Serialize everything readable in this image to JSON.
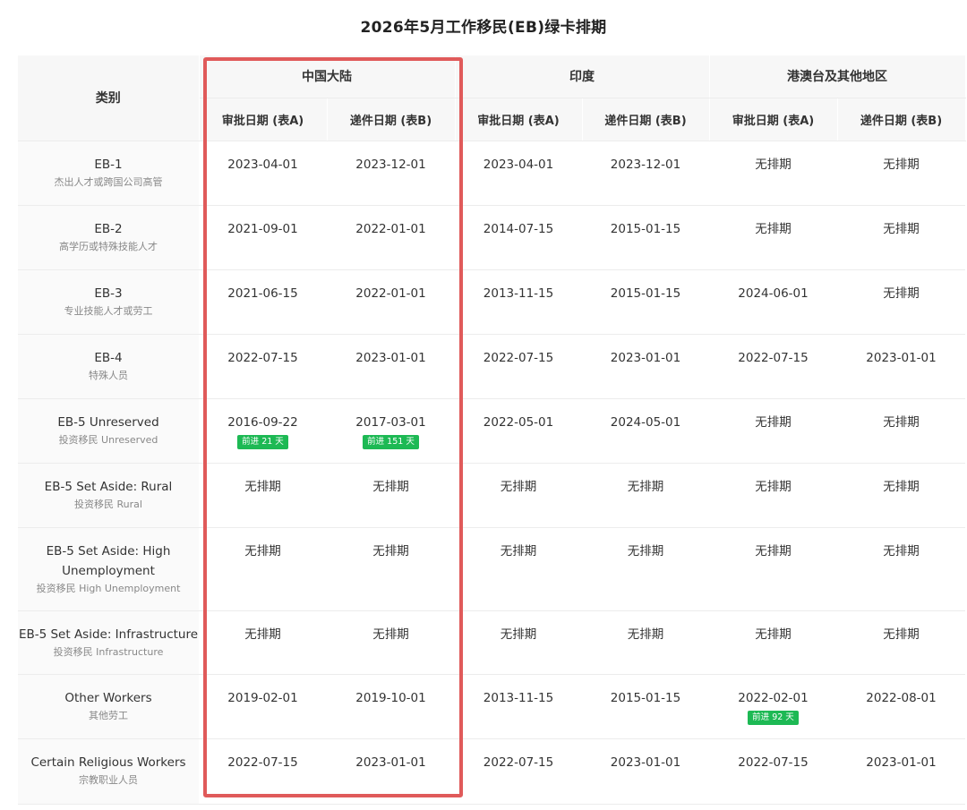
{
  "title": "2026年5月工作移民(EB)绿卡排期",
  "headers": {
    "category": "类别",
    "regions": [
      "中国大陆",
      "印度",
      "港澳台及其他地区"
    ],
    "table_a": "审批日期 (表A)",
    "table_b": "递件日期 (表B)"
  },
  "rows": [
    {
      "name": "EB-1",
      "sub": "杰出人才或跨国公司高管",
      "cells": [
        {
          "v": "2023-04-01"
        },
        {
          "v": "2023-12-01"
        },
        {
          "v": "2023-04-01"
        },
        {
          "v": "2023-12-01"
        },
        {
          "v": "无排期"
        },
        {
          "v": "无排期"
        }
      ]
    },
    {
      "name": "EB-2",
      "sub": "高学历或特殊技能人才",
      "cells": [
        {
          "v": "2021-09-01"
        },
        {
          "v": "2022-01-01"
        },
        {
          "v": "2014-07-15"
        },
        {
          "v": "2015-01-15"
        },
        {
          "v": "无排期"
        },
        {
          "v": "无排期"
        }
      ]
    },
    {
      "name": "EB-3",
      "sub": "专业技能人才或劳工",
      "cells": [
        {
          "v": "2021-06-15"
        },
        {
          "v": "2022-01-01"
        },
        {
          "v": "2013-11-15"
        },
        {
          "v": "2015-01-15"
        },
        {
          "v": "2024-06-01"
        },
        {
          "v": "无排期"
        }
      ]
    },
    {
      "name": "EB-4",
      "sub": "特殊人员",
      "cells": [
        {
          "v": "2022-07-15"
        },
        {
          "v": "2023-01-01"
        },
        {
          "v": "2022-07-15"
        },
        {
          "v": "2023-01-01"
        },
        {
          "v": "2022-07-15"
        },
        {
          "v": "2023-01-01"
        }
      ]
    },
    {
      "name": "EB-5 Unreserved",
      "sub": "投资移民 Unreserved",
      "cells": [
        {
          "v": "2016-09-22",
          "badge": "前进 21 天"
        },
        {
          "v": "2017-03-01",
          "badge": "前进 151 天"
        },
        {
          "v": "2022-05-01"
        },
        {
          "v": "2024-05-01"
        },
        {
          "v": "无排期"
        },
        {
          "v": "无排期"
        }
      ]
    },
    {
      "name": "EB-5 Set Aside: Rural",
      "sub": "投资移民 Rural",
      "cells": [
        {
          "v": "无排期"
        },
        {
          "v": "无排期"
        },
        {
          "v": "无排期"
        },
        {
          "v": "无排期"
        },
        {
          "v": "无排期"
        },
        {
          "v": "无排期"
        }
      ]
    },
    {
      "name": "EB-5 Set Aside: High Unemployment",
      "sub": "投资移民 High Unemployment",
      "cells": [
        {
          "v": "无排期"
        },
        {
          "v": "无排期"
        },
        {
          "v": "无排期"
        },
        {
          "v": "无排期"
        },
        {
          "v": "无排期"
        },
        {
          "v": "无排期"
        }
      ]
    },
    {
      "name": "EB-5 Set Aside: Infrastructure",
      "sub": "投资移民 Infrastructure",
      "cells": [
        {
          "v": "无排期"
        },
        {
          "v": "无排期"
        },
        {
          "v": "无排期"
        },
        {
          "v": "无排期"
        },
        {
          "v": "无排期"
        },
        {
          "v": "无排期"
        }
      ]
    },
    {
      "name": "Other Workers",
      "sub": "其他劳工",
      "cells": [
        {
          "v": "2019-02-01"
        },
        {
          "v": "2019-10-01"
        },
        {
          "v": "2013-11-15"
        },
        {
          "v": "2015-01-15"
        },
        {
          "v": "2022-02-01",
          "badge": "前进 92 天"
        },
        {
          "v": "2022-08-01"
        }
      ]
    },
    {
      "name": "Certain Religious Workers",
      "sub": "宗教职业人员",
      "cells": [
        {
          "v": "2022-07-15"
        },
        {
          "v": "2023-01-01"
        },
        {
          "v": "2022-07-15"
        },
        {
          "v": "2023-01-01"
        },
        {
          "v": "2022-07-15"
        },
        {
          "v": "2023-01-01"
        }
      ]
    }
  ],
  "colors": {
    "highlight": "#e05a5a",
    "badge": "#1db954",
    "header_bg": "#f7f7f7"
  }
}
